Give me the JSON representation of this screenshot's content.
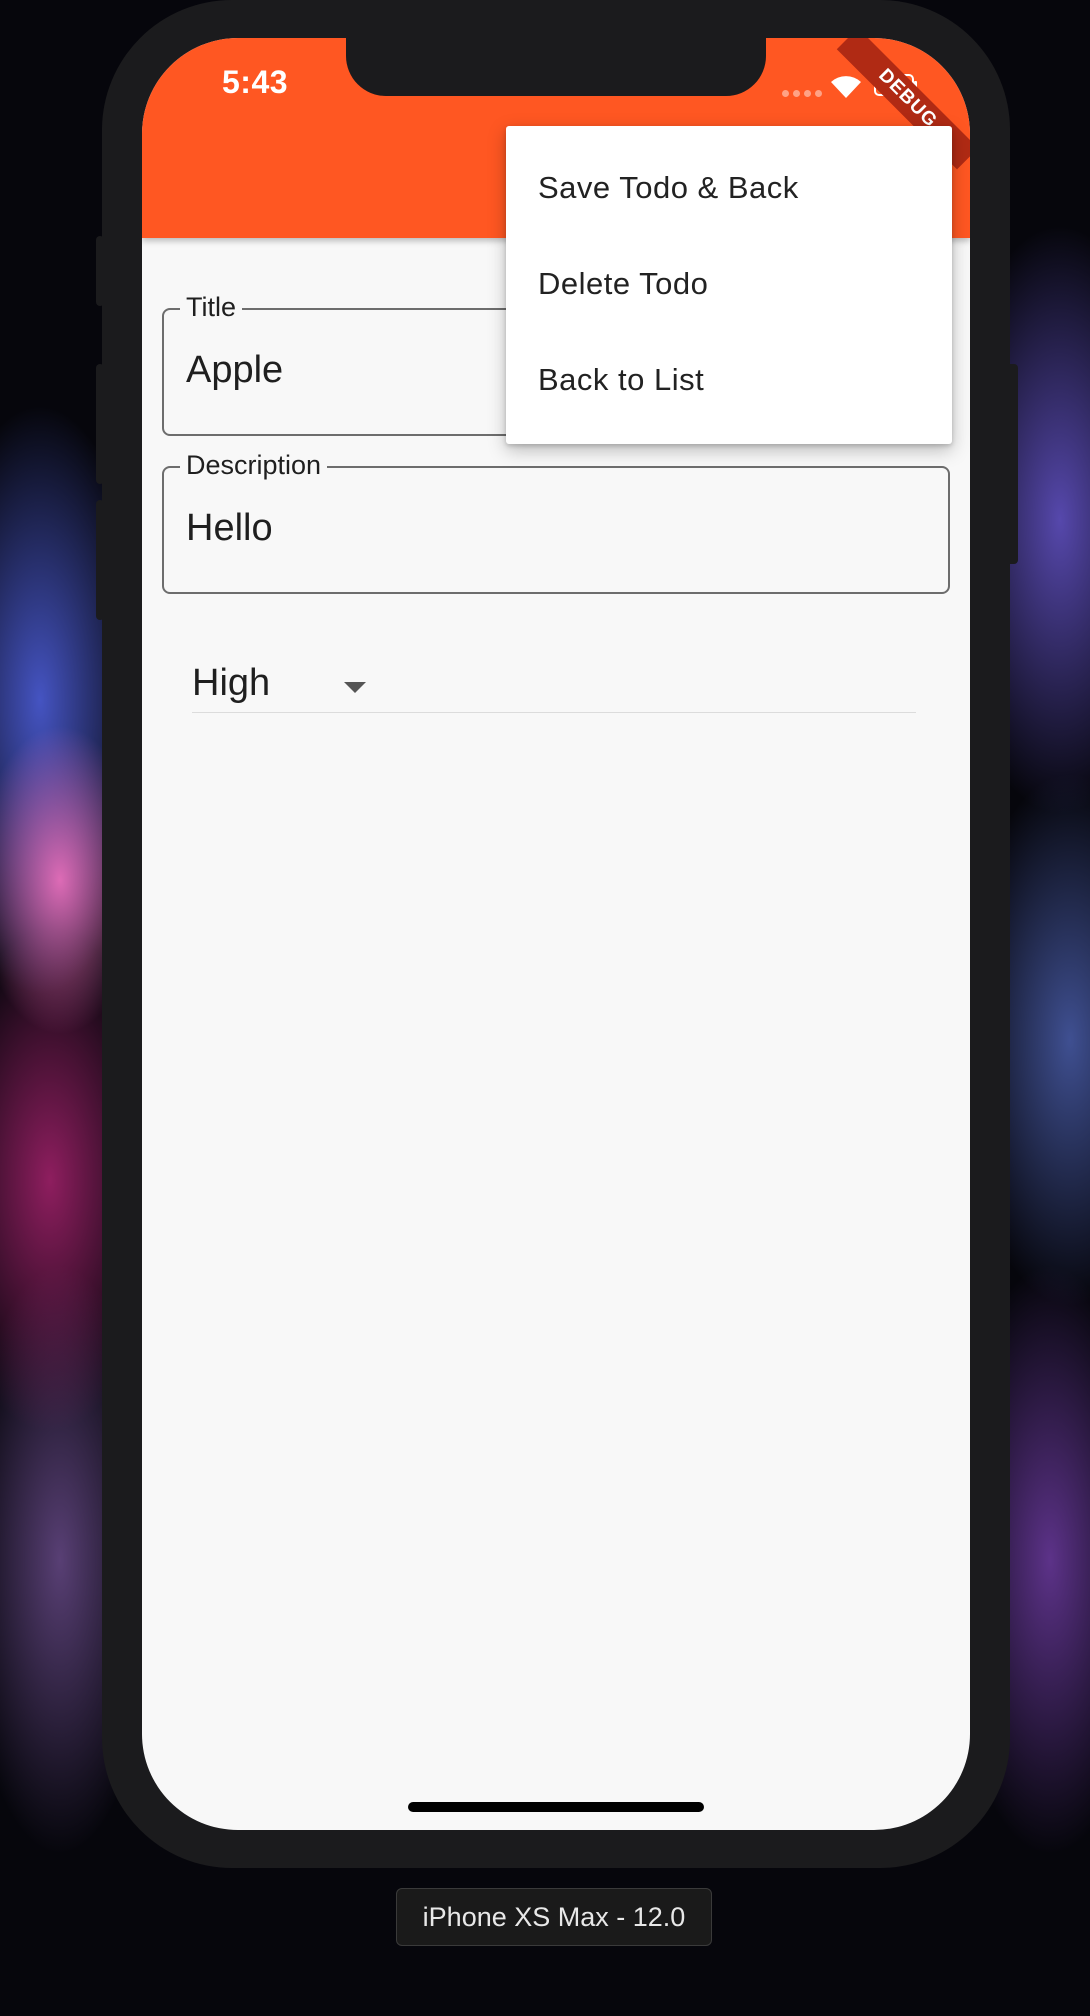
{
  "status_bar": {
    "time": "5:43",
    "debug_banner": "DEBUG"
  },
  "menu": {
    "items": [
      {
        "label": "Save Todo & Back"
      },
      {
        "label": "Delete Todo"
      },
      {
        "label": "Back to List"
      }
    ]
  },
  "form": {
    "title_label": "Title",
    "title_value": "Apple",
    "description_label": "Description",
    "description_value": "Hello",
    "priority_value": "High"
  },
  "simulator": {
    "device_label": "iPhone XS Max - 12.0"
  },
  "colors": {
    "app_bar": "#ff5722",
    "background": "#f8f8f8",
    "debug_ribbon": "#b02a14"
  }
}
